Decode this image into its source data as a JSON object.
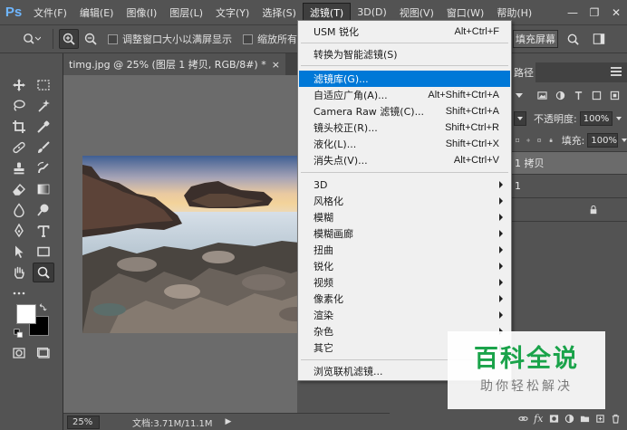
{
  "app": {
    "logo": "Ps"
  },
  "menubar": {
    "items": [
      "文件(F)",
      "编辑(E)",
      "图像(I)",
      "图层(L)",
      "文字(Y)",
      "选择(S)",
      "滤镜(T)",
      "3D(D)",
      "视图(V)",
      "窗口(W)",
      "帮助(H)"
    ],
    "active_index": 6,
    "window_controls": {
      "minimize": "—",
      "restore": "❐",
      "close": "✕"
    }
  },
  "options_bar": {
    "resize_windows_label": "调整窗口大小以满屏显示",
    "zoom_all_label": "缩放所有",
    "fill_screen_label": "填充屏幕",
    "search_icon": "search-icon",
    "workspace_icon": "workspace-icon"
  },
  "document": {
    "tab_title": "timg.jpg @ 25% (图层 1 拷贝, RGB/8#) *",
    "tab_close": "×"
  },
  "filter_menu": {
    "groups": [
      [
        {
          "label": "USM 锐化",
          "shortcut": "Alt+Ctrl+F"
        }
      ],
      [
        {
          "label": "转换为智能滤镜(S)",
          "shortcut": ""
        }
      ],
      [
        {
          "label": "滤镜库(G)...",
          "shortcut": "",
          "highlighted": true
        },
        {
          "label": "自适应广角(A)...",
          "shortcut": "Alt+Shift+Ctrl+A"
        },
        {
          "label": "Camera Raw 滤镜(C)...",
          "shortcut": "Shift+Ctrl+A"
        },
        {
          "label": "镜头校正(R)...",
          "shortcut": "Shift+Ctrl+R"
        },
        {
          "label": "液化(L)...",
          "shortcut": "Shift+Ctrl+X"
        },
        {
          "label": "消失点(V)...",
          "shortcut": "Alt+Ctrl+V"
        }
      ],
      [
        {
          "label": "3D",
          "submenu": true
        },
        {
          "label": "风格化",
          "submenu": true
        },
        {
          "label": "模糊",
          "submenu": true
        },
        {
          "label": "模糊画廊",
          "submenu": true
        },
        {
          "label": "扭曲",
          "submenu": true
        },
        {
          "label": "锐化",
          "submenu": true
        },
        {
          "label": "视频",
          "submenu": true
        },
        {
          "label": "像素化",
          "submenu": true
        },
        {
          "label": "渲染",
          "submenu": true
        },
        {
          "label": "杂色",
          "submenu": true
        },
        {
          "label": "其它",
          "submenu": true
        }
      ],
      [
        {
          "label": "浏览联机滤镜...",
          "shortcut": ""
        }
      ]
    ]
  },
  "panels": {
    "paths_tab_label": "路径",
    "opacity_label": "不透明度:",
    "opacity_value": "100%",
    "fill_label": "填充:",
    "fill_value": "100%",
    "layers": [
      "1 拷贝",
      "1"
    ]
  },
  "statusbar": {
    "zoom": "25%",
    "doc_info": "文档:3.71M/11.1M",
    "arrow": "▶"
  },
  "watermark": {
    "title": "百科全说",
    "subtitle": "助你轻松解决"
  },
  "colors": {
    "app_bg": "#535353",
    "canvas_bg": "#6b6b6b",
    "menu_bg": "#f0f0f0",
    "menu_highlight": "#0078d7",
    "ps_blue": "#6fb6ff",
    "watermark_green": "#1aa34a"
  }
}
